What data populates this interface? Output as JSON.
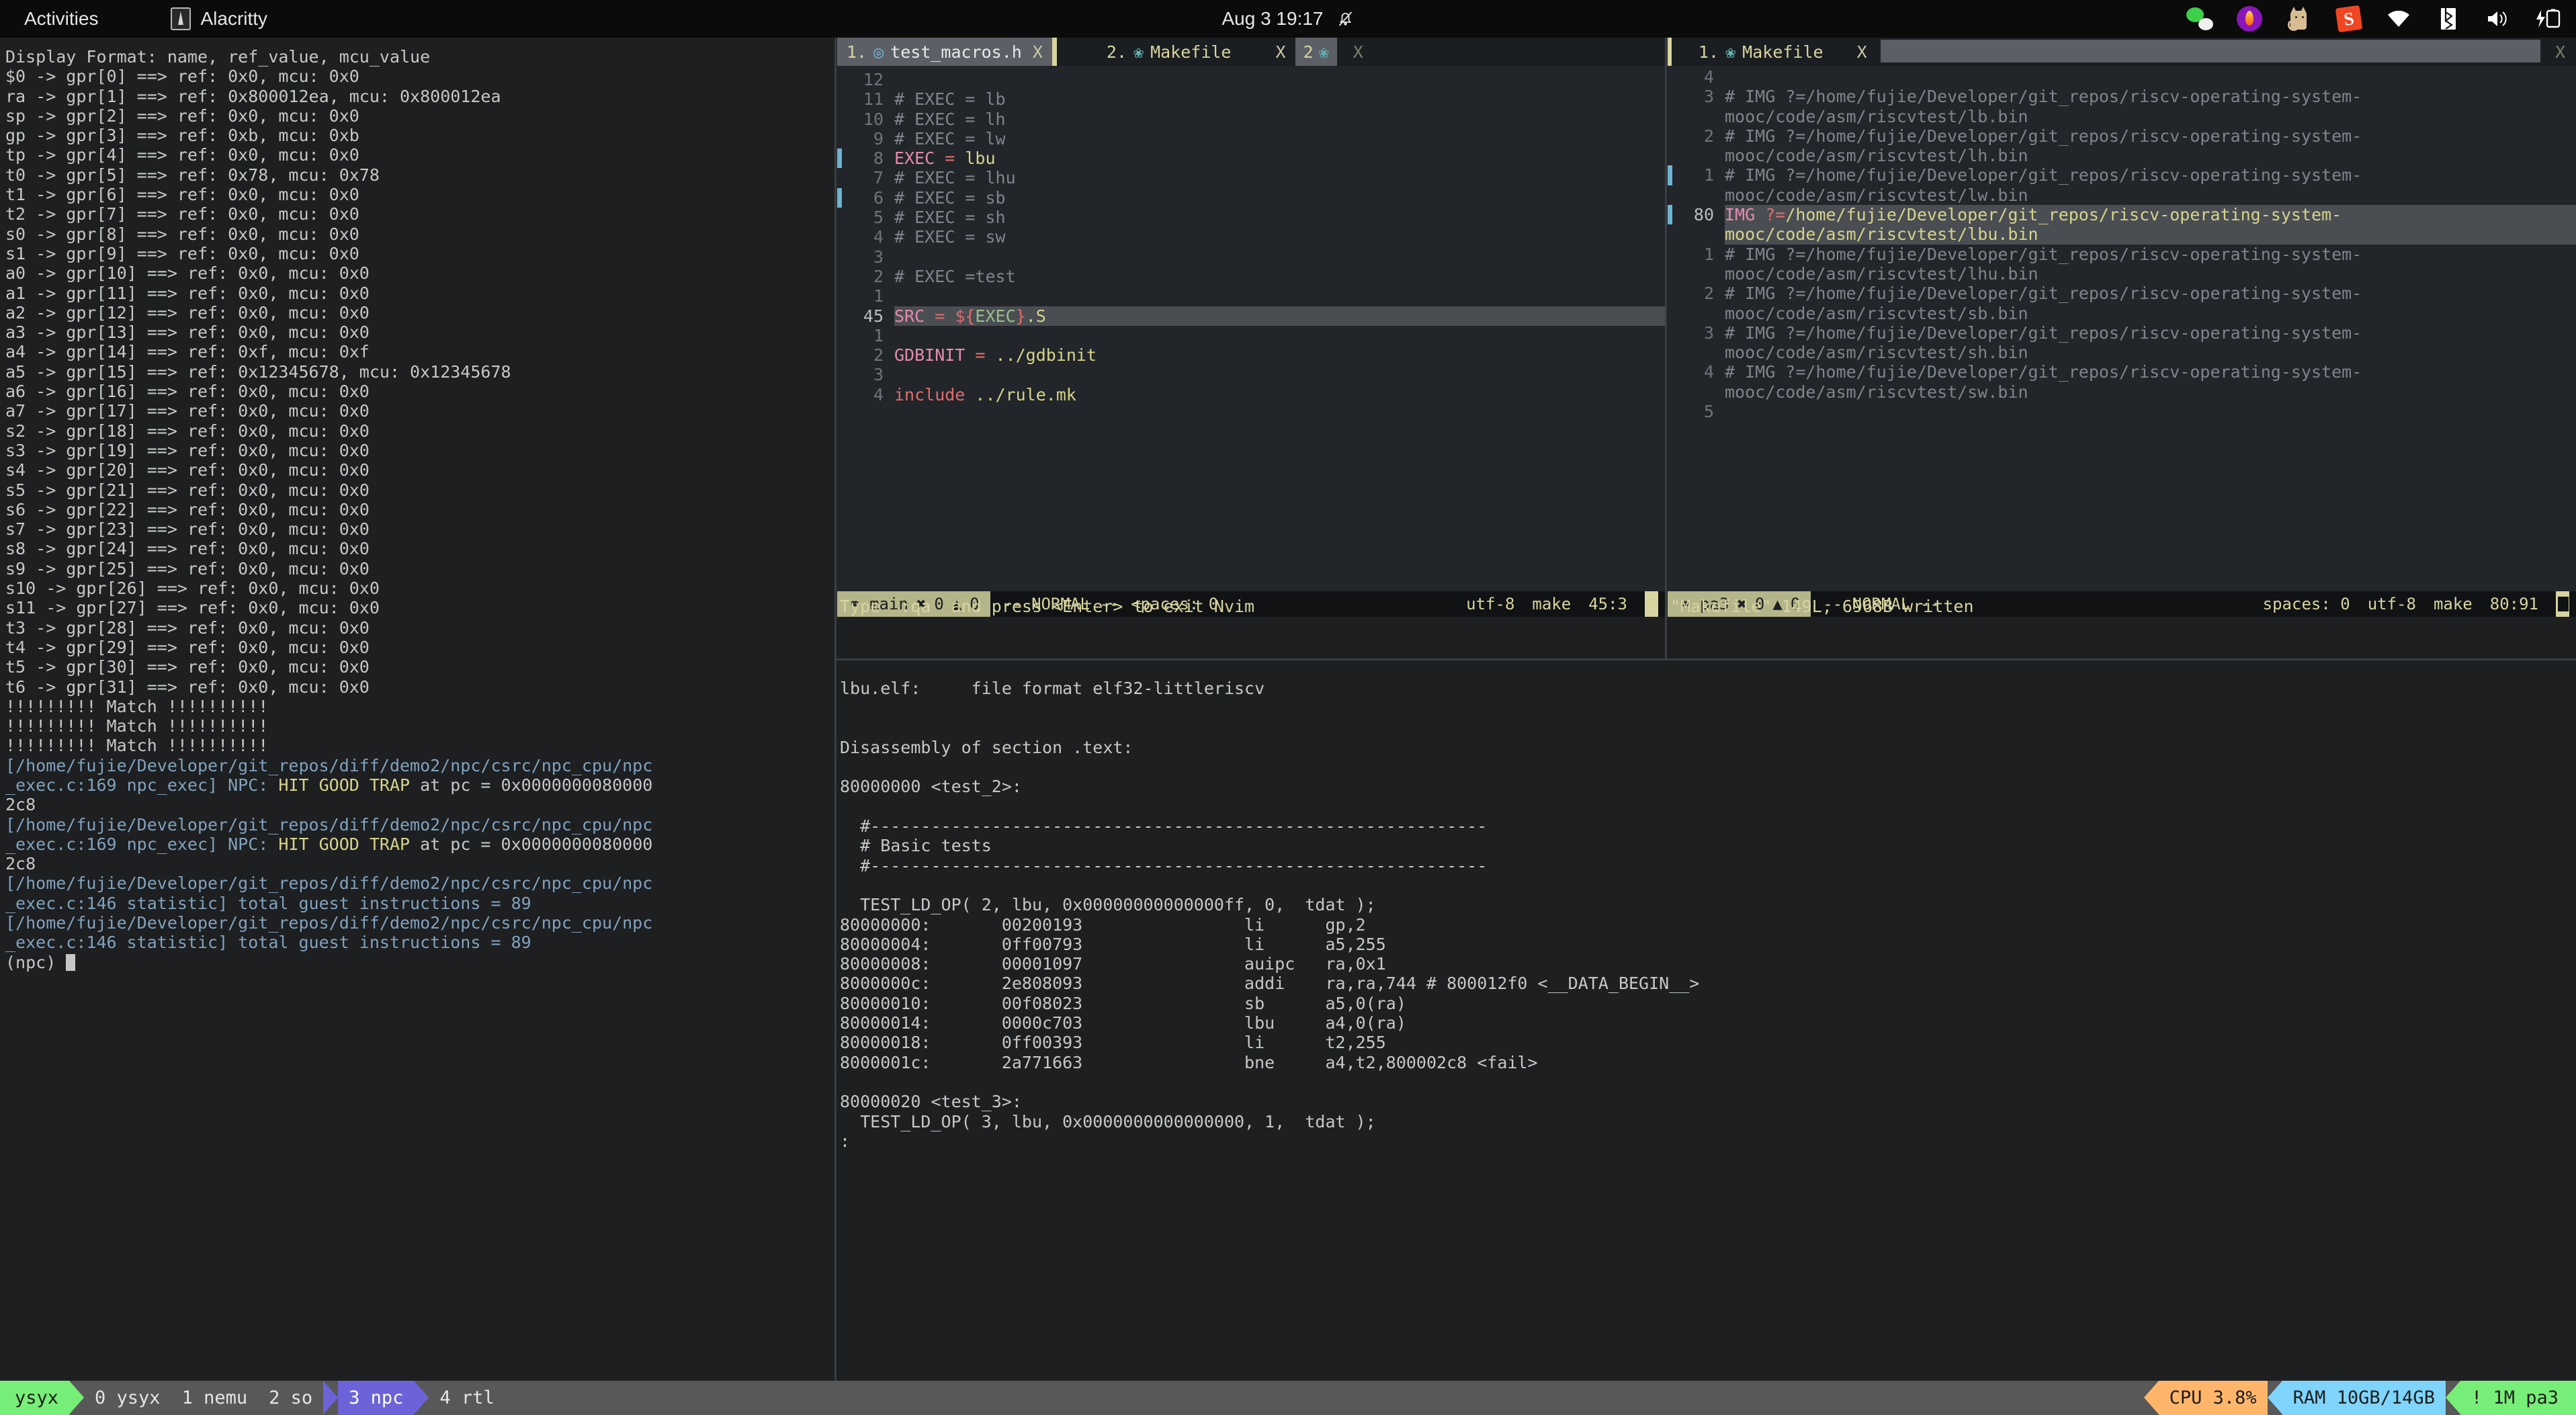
{
  "topbar": {
    "activities": "Activities",
    "app_name": "Alacritty",
    "clock": "Aug 3  19:17",
    "tray": [
      "wechat-icon",
      "flame-icon",
      "cat-icon",
      "sogou-icon",
      "wifi-icon",
      "bluetooth-icon",
      "volume-icon",
      "battery-charging-icon"
    ]
  },
  "left_terminal": {
    "lines": [
      {
        "t": "Display Format: name, ref_value, mcu_value"
      },
      {
        "t": "$0 -> gpr[0] ==> ref: 0x0, mcu: 0x0"
      },
      {
        "t": "ra -> gpr[1] ==> ref: 0x800012ea, mcu: 0x800012ea"
      },
      {
        "t": "sp -> gpr[2] ==> ref: 0x0, mcu: 0x0"
      },
      {
        "t": "gp -> gpr[3] ==> ref: 0xb, mcu: 0xb"
      },
      {
        "t": "tp -> gpr[4] ==> ref: 0x0, mcu: 0x0"
      },
      {
        "t": "t0 -> gpr[5] ==> ref: 0x78, mcu: 0x78"
      },
      {
        "t": "t1 -> gpr[6] ==> ref: 0x0, mcu: 0x0"
      },
      {
        "t": "t2 -> gpr[7] ==> ref: 0x0, mcu: 0x0"
      },
      {
        "t": "s0 -> gpr[8] ==> ref: 0x0, mcu: 0x0"
      },
      {
        "t": "s1 -> gpr[9] ==> ref: 0x0, mcu: 0x0"
      },
      {
        "t": "a0 -> gpr[10] ==> ref: 0x0, mcu: 0x0"
      },
      {
        "t": "a1 -> gpr[11] ==> ref: 0x0, mcu: 0x0"
      },
      {
        "t": "a2 -> gpr[12] ==> ref: 0x0, mcu: 0x0"
      },
      {
        "t": "a3 -> gpr[13] ==> ref: 0x0, mcu: 0x0"
      },
      {
        "t": "a4 -> gpr[14] ==> ref: 0xf, mcu: 0xf"
      },
      {
        "t": "a5 -> gpr[15] ==> ref: 0x12345678, mcu: 0x12345678"
      },
      {
        "t": "a6 -> gpr[16] ==> ref: 0x0, mcu: 0x0"
      },
      {
        "t": "a7 -> gpr[17] ==> ref: 0x0, mcu: 0x0"
      },
      {
        "t": "s2 -> gpr[18] ==> ref: 0x0, mcu: 0x0"
      },
      {
        "t": "s3 -> gpr[19] ==> ref: 0x0, mcu: 0x0"
      },
      {
        "t": "s4 -> gpr[20] ==> ref: 0x0, mcu: 0x0"
      },
      {
        "t": "s5 -> gpr[21] ==> ref: 0x0, mcu: 0x0"
      },
      {
        "t": "s6 -> gpr[22] ==> ref: 0x0, mcu: 0x0"
      },
      {
        "t": "s7 -> gpr[23] ==> ref: 0x0, mcu: 0x0"
      },
      {
        "t": "s8 -> gpr[24] ==> ref: 0x0, mcu: 0x0"
      },
      {
        "t": "s9 -> gpr[25] ==> ref: 0x0, mcu: 0x0"
      },
      {
        "t": "s10 -> gpr[26] ==> ref: 0x0, mcu: 0x0"
      },
      {
        "t": "s11 -> gpr[27] ==> ref: 0x0, mcu: 0x0"
      },
      {
        "t": "t3 -> gpr[28] ==> ref: 0x0, mcu: 0x0"
      },
      {
        "t": "t4 -> gpr[29] ==> ref: 0x0, mcu: 0x0"
      },
      {
        "t": "t5 -> gpr[30] ==> ref: 0x0, mcu: 0x0"
      },
      {
        "t": "t6 -> gpr[31] ==> ref: 0x0, mcu: 0x0"
      },
      {
        "t": "!!!!!!!!! Match !!!!!!!!!!"
      },
      {
        "t": "!!!!!!!!! Match !!!!!!!!!!"
      },
      {
        "t": "!!!!!!!!! Match !!!!!!!!!!"
      },
      {
        "t": "[/home/fujie/Developer/git_repos/diff/demo2/npc/csrc/npc_cpu/npc",
        "c": "blue"
      },
      {
        "parts": [
          {
            "t": "_exec.c:169 npc_exec] NPC: ",
            "c": "blue"
          },
          {
            "t": "HIT GOOD TRAP",
            "c": "yellow"
          },
          {
            "t": " at pc = 0x0000000080000",
            "c": "plain"
          }
        ]
      },
      {
        "t": "2c8"
      },
      {
        "t": "[/home/fujie/Developer/git_repos/diff/demo2/npc/csrc/npc_cpu/npc",
        "c": "blue"
      },
      {
        "parts": [
          {
            "t": "_exec.c:169 npc_exec] NPC: ",
            "c": "blue"
          },
          {
            "t": "HIT GOOD TRAP",
            "c": "yellow"
          },
          {
            "t": " at pc = 0x0000000080000",
            "c": "plain"
          }
        ]
      },
      {
        "t": "2c8"
      },
      {
        "t": "[/home/fujie/Developer/git_repos/diff/demo2/npc/csrc/npc_cpu/npc",
        "c": "blue"
      },
      {
        "t": "_exec.c:146 statistic] total guest instructions = 89",
        "c": "blue"
      },
      {
        "t": "[/home/fujie/Developer/git_repos/diff/demo2/npc/csrc/npc_cpu/npc",
        "c": "blue"
      },
      {
        "t": "_exec.c:146 statistic] total guest instructions = 89",
        "c": "blue"
      },
      {
        "t": "(npc) ",
        "cursor": true
      }
    ]
  },
  "center_nvim": {
    "tabs": [
      {
        "num": "1.",
        "icon": "c-file-icon",
        "name": "test_macros.h",
        "close": "X",
        "active": true
      },
      {
        "num": "2.",
        "icon": "gear-icon",
        "name": "Makefile",
        "close": "X",
        "active": false
      }
    ],
    "tab_badge": "2",
    "tab_badge_icon": "gear-icon",
    "tab_close_all": "X",
    "lines": [
      {
        "num": "12",
        "mark": false,
        "parts": [
          {
            "t": "",
            "c": "grey"
          }
        ]
      },
      {
        "num": "11",
        "mark": false,
        "parts": [
          {
            "t": "# EXEC = lb",
            "c": "grey"
          }
        ]
      },
      {
        "num": "10",
        "mark": false,
        "parts": [
          {
            "t": "# EXEC = lh",
            "c": "grey"
          }
        ]
      },
      {
        "num": "9",
        "mark": false,
        "parts": [
          {
            "t": "# EXEC = lw",
            "c": "grey"
          }
        ]
      },
      {
        "num": "8",
        "mark": true,
        "parts": [
          {
            "t": "EXEC",
            "c": "pink"
          },
          {
            "t": " = ",
            "c": "red"
          },
          {
            "t": "lbu",
            "c": "yellow"
          }
        ]
      },
      {
        "num": "7",
        "mark": false,
        "parts": [
          {
            "t": "# EXEC = lhu",
            "c": "grey"
          }
        ]
      },
      {
        "num": "6",
        "mark": true,
        "parts": [
          {
            "t": "# EXEC = sb",
            "c": "grey"
          }
        ]
      },
      {
        "num": "5",
        "mark": false,
        "parts": [
          {
            "t": "# EXEC = sh",
            "c": "grey"
          }
        ]
      },
      {
        "num": "4",
        "mark": false,
        "parts": [
          {
            "t": "# EXEC = sw",
            "c": "grey"
          }
        ]
      },
      {
        "num": "3",
        "mark": false,
        "parts": [
          {
            "t": "",
            "c": "grey"
          }
        ]
      },
      {
        "num": "2",
        "mark": false,
        "parts": [
          {
            "t": "# EXEC =test",
            "c": "grey"
          }
        ]
      },
      {
        "num": "1",
        "mark": false,
        "parts": [
          {
            "t": "",
            "c": "grey"
          }
        ]
      },
      {
        "num": "45",
        "mark": false,
        "cursor": true,
        "parts": [
          {
            "t": "SRC",
            "c": "pink"
          },
          {
            "t": " = ",
            "c": "red"
          },
          {
            "t": "${",
            "c": "red"
          },
          {
            "t": "EXEC",
            "c": "green"
          },
          {
            "t": "}",
            "c": "red"
          },
          {
            "t": ".S",
            "c": "yellow"
          }
        ]
      },
      {
        "num": "1",
        "mark": false,
        "parts": [
          {
            "t": "",
            "c": "grey"
          }
        ]
      },
      {
        "num": "2",
        "mark": false,
        "parts": [
          {
            "t": "GDBINIT",
            "c": "pink"
          },
          {
            "t": " = ",
            "c": "red"
          },
          {
            "t": "../gdbinit",
            "c": "yellow"
          }
        ]
      },
      {
        "num": "3",
        "mark": false,
        "parts": [
          {
            "t": "",
            "c": "grey"
          }
        ]
      },
      {
        "num": "4",
        "mark": false,
        "parts": [
          {
            "t": "include ",
            "c": "red"
          },
          {
            "t": "../rule.mk",
            "c": "yellow"
          }
        ]
      }
    ],
    "status": {
      "branch_icon": "git-branch-icon",
      "branch": "main",
      "error_icon": "error-icon",
      "errors": "0",
      "warn_icon": "warning-icon",
      "warnings": "0",
      "mode": "-- NORMAL --",
      "spaces": "<paces: 0",
      "encoding": "utf-8",
      "filetype": "make",
      "position": "45:3"
    },
    "message": "Type  :qa  and press <Enter> to exit Nvim"
  },
  "right_nvim": {
    "tabs": [
      {
        "num": "1.",
        "icon": "gear-icon",
        "name": "Makefile",
        "close": "X",
        "active": false
      }
    ],
    "tab_close_all": "X",
    "lines": [
      {
        "num": "4",
        "mark": false,
        "parts": [
          {
            "t": "",
            "c": "grey"
          }
        ]
      },
      {
        "num": "3",
        "mark": false,
        "parts": [
          {
            "t": "# IMG ?=/home/fujie/Developer/git_repos/riscv-operating-system-",
            "c": "grey"
          }
        ]
      },
      {
        "num": "",
        "mark": false,
        "parts": [
          {
            "t": "mooc/code/asm/riscvtest/lb.bin",
            "c": "grey"
          }
        ]
      },
      {
        "num": "2",
        "mark": false,
        "parts": [
          {
            "t": "# IMG ?=/home/fujie/Developer/git_repos/riscv-operating-system-",
            "c": "grey"
          }
        ]
      },
      {
        "num": "",
        "mark": false,
        "parts": [
          {
            "t": "mooc/code/asm/riscvtest/lh.bin",
            "c": "grey"
          }
        ]
      },
      {
        "num": "1",
        "mark": true,
        "parts": [
          {
            "t": "# IMG ?=/home/fujie/Developer/git_repos/riscv-operating-system-",
            "c": "grey"
          }
        ]
      },
      {
        "num": "",
        "mark": false,
        "parts": [
          {
            "t": "mooc/code/asm/riscvtest/lw.bin",
            "c": "grey"
          }
        ]
      },
      {
        "num": "80",
        "mark": true,
        "cursor": true,
        "parts": [
          {
            "t": "IMG",
            "c": "pink"
          },
          {
            "t": " ?=",
            "c": "red"
          },
          {
            "t": "/home/fujie/Developer/git_repos/riscv-operating-system-",
            "c": "yellow"
          }
        ]
      },
      {
        "num": "",
        "mark": false,
        "cursor": true,
        "parts": [
          {
            "t": "mooc/code/asm/riscvtest/lbu.bin",
            "c": "yellow"
          }
        ]
      },
      {
        "num": "1",
        "mark": false,
        "parts": [
          {
            "t": "# IMG ?=/home/fujie/Developer/git_repos/riscv-operating-system-",
            "c": "grey"
          }
        ]
      },
      {
        "num": "",
        "mark": false,
        "parts": [
          {
            "t": "mooc/code/asm/riscvtest/lhu.bin",
            "c": "grey"
          }
        ]
      },
      {
        "num": "2",
        "mark": false,
        "parts": [
          {
            "t": "# IMG ?=/home/fujie/Developer/git_repos/riscv-operating-system-",
            "c": "grey"
          }
        ]
      },
      {
        "num": "",
        "mark": false,
        "parts": [
          {
            "t": "mooc/code/asm/riscvtest/sb.bin",
            "c": "grey"
          }
        ]
      },
      {
        "num": "3",
        "mark": false,
        "parts": [
          {
            "t": "# IMG ?=/home/fujie/Developer/git_repos/riscv-operating-system-",
            "c": "grey"
          }
        ]
      },
      {
        "num": "",
        "mark": false,
        "parts": [
          {
            "t": "mooc/code/asm/riscvtest/sh.bin",
            "c": "grey"
          }
        ]
      },
      {
        "num": "4",
        "mark": false,
        "parts": [
          {
            "t": "# IMG ?=/home/fujie/Developer/git_repos/riscv-operating-system-",
            "c": "grey"
          }
        ]
      },
      {
        "num": "",
        "mark": false,
        "parts": [
          {
            "t": "mooc/code/asm/riscvtest/sw.bin",
            "c": "grey"
          }
        ]
      },
      {
        "num": "5",
        "mark": false,
        "parts": [
          {
            "t": "",
            "c": "grey"
          }
        ]
      }
    ],
    "status": {
      "branch_icon": "git-branch-icon",
      "branch": "pa3",
      "error_icon": "error-icon",
      "errors": "0",
      "warn_icon": "warning-icon",
      "warnings": "0",
      "mode": "-- NORMAL --",
      "spaces": "spaces: 0",
      "encoding": "utf-8",
      "filetype": "make",
      "position": "80:91"
    },
    "message": "\"Makefile\" 149L, 6968B written"
  },
  "bottom_output": {
    "lines": [
      "lbu.elf:     file format elf32-littleriscv",
      "",
      "",
      "Disassembly of section .text:",
      "",
      "80000000 <test_2>:",
      "",
      "  #-------------------------------------------------------------",
      "  # Basic tests",
      "  #-------------------------------------------------------------",
      "",
      "  TEST_LD_OP( 2, lbu, 0x00000000000000ff, 0,  tdat );",
      "80000000:       00200193                li      gp,2",
      "80000004:       0ff00793                li      a5,255",
      "80000008:       00001097                auipc   ra,0x1",
      "8000000c:       2e808093                addi    ra,ra,744 # 800012f0 <__DATA_BEGIN__>",
      "80000010:       00f08023                sb      a5,0(ra)",
      "80000014:       0000c703                lbu     a4,0(ra)",
      "80000018:       0ff00393                li      t2,255",
      "8000001c:       2a771663                bne     a4,t2,800002c8 <fail>",
      "",
      "80000020 <test_3>:",
      "  TEST_LD_OP( 3, lbu, 0x0000000000000000, 1,  tdat );",
      ":"
    ]
  },
  "tmux": {
    "session": "ysyx",
    "windows": [
      {
        "label": "0 ysyx",
        "active": false
      },
      {
        "label": "1 nemu",
        "active": false
      },
      {
        "label": "2 so",
        "active": false
      },
      {
        "label": "3 npc",
        "active": true
      },
      {
        "label": "4 rtl",
        "active": false
      }
    ],
    "cpu": "CPU  3.8%",
    "ram": "RAM 10GB/14GB",
    "branch": "! 1M pa3"
  },
  "colors": {
    "bg": "#1d1f21",
    "pink": "#e58ab0",
    "yellow": "#d7d48a",
    "blue": "#81a2be",
    "accent_green": "#77ee77",
    "accent_purple": "#6c63d8",
    "cpu_orange": "#ffb66b",
    "ram_blue": "#7fd4fb"
  }
}
